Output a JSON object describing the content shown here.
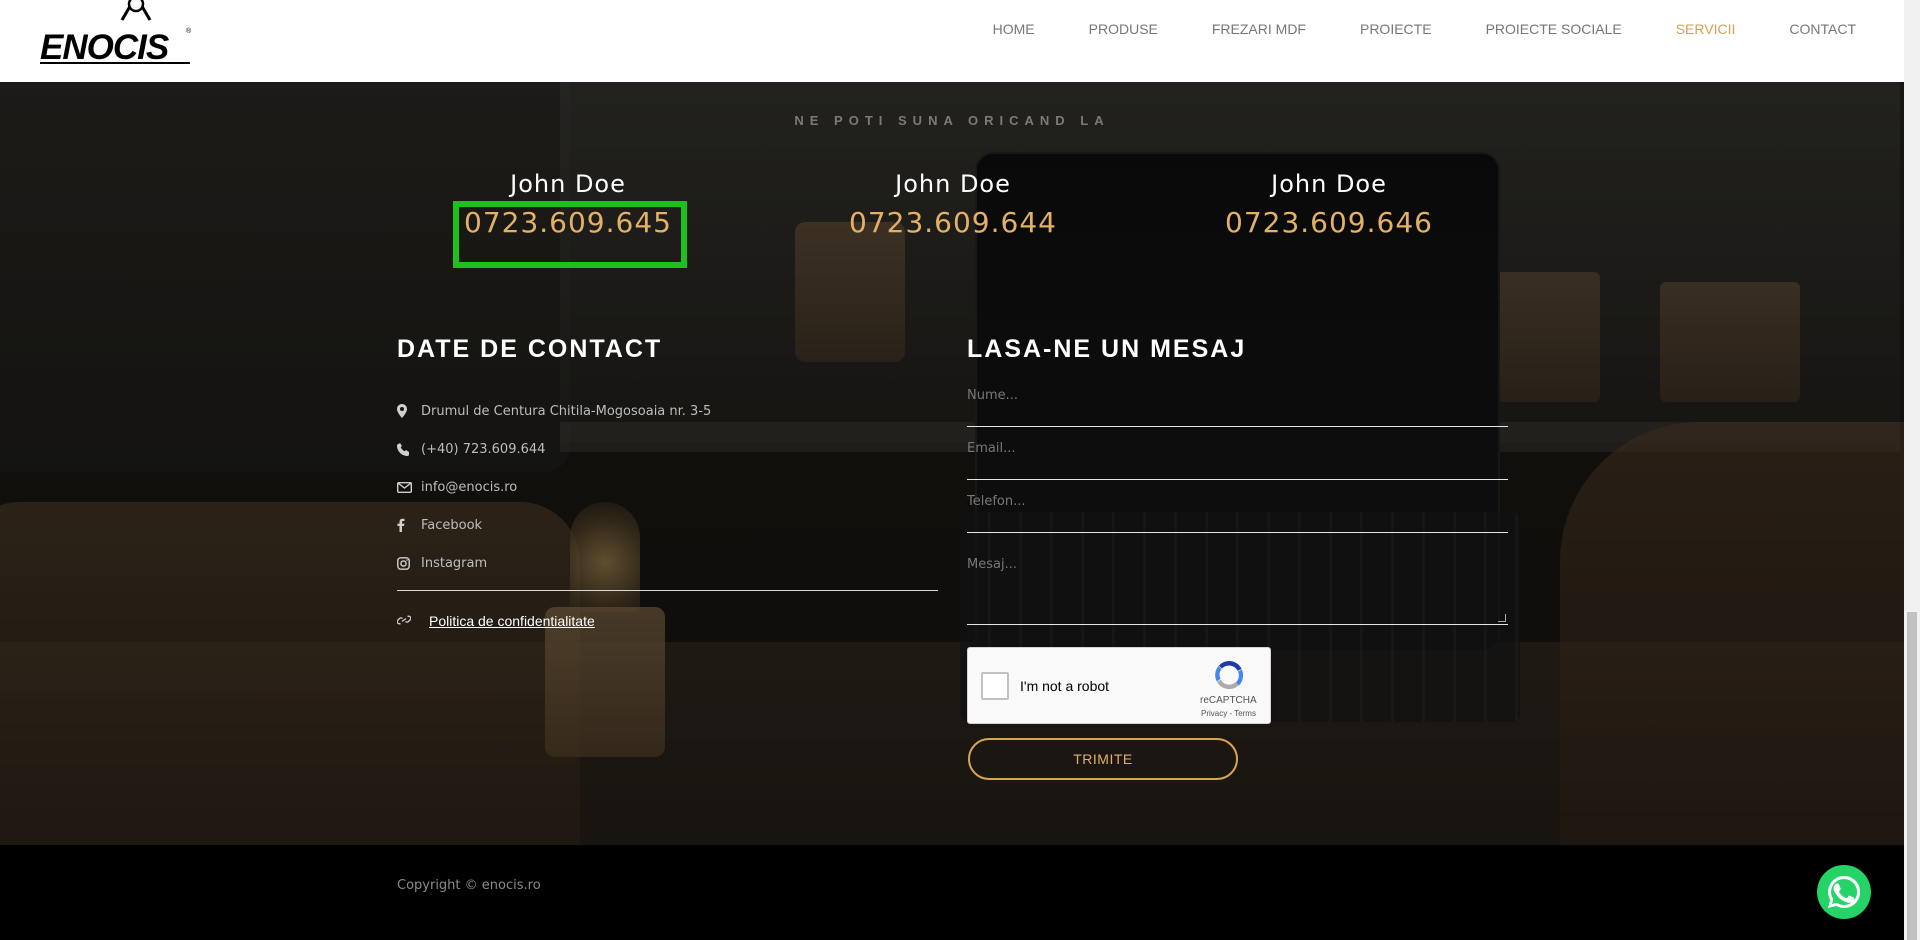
{
  "header": {
    "logo_text": "ENOCIS",
    "nav": [
      {
        "label": "HOME",
        "active": false
      },
      {
        "label": "PRODUSE",
        "active": false
      },
      {
        "label": "FREZARI MDF",
        "active": false
      },
      {
        "label": "PROIECTE",
        "active": false
      },
      {
        "label": "PROIECTE SOCIALE",
        "active": false
      },
      {
        "label": "SERVICII",
        "active": true
      },
      {
        "label": "CONTACT",
        "active": false
      }
    ]
  },
  "call": {
    "tagline": "NE POTI SUNA ORICAND LA",
    "contacts": [
      {
        "name": "John Doe",
        "phone": "0723.609.645",
        "highlighted": true
      },
      {
        "name": "John Doe",
        "phone": "0723.609.644",
        "highlighted": false
      },
      {
        "name": "John Doe",
        "phone": "0723.609.646",
        "highlighted": false
      }
    ]
  },
  "contact_info": {
    "title": "DATE DE CONTACT",
    "items": [
      {
        "icon": "map-pin-icon",
        "text": "Drumul de Centura Chitila-Mogosoaia nr. 3-5"
      },
      {
        "icon": "phone-icon",
        "text": "(+40) 723.609.644"
      },
      {
        "icon": "envelope-icon",
        "text": "info@enocis.ro"
      },
      {
        "icon": "facebook-icon",
        "text": "Facebook"
      },
      {
        "icon": "instagram-icon",
        "text": "Instagram"
      }
    ],
    "policy_label": "Politica de confidentialitate"
  },
  "message_form": {
    "title": "LASA-NE UN MESAJ",
    "name_placeholder": "Nume...",
    "email_placeholder": "Email...",
    "phone_placeholder": "Telefon...",
    "message_placeholder": "Mesaj...",
    "recaptcha_label": "I'm not a robot",
    "recaptcha_brand": "reCAPTCHA",
    "recaptcha_terms": "Privacy - Terms",
    "submit_label": "TRIMITE"
  },
  "footer": {
    "copyright": "Copyright © enocis.ro"
  },
  "colors": {
    "accent": "#e3b165",
    "highlight_box": "#1cc11c",
    "whatsapp": "#25d366"
  }
}
